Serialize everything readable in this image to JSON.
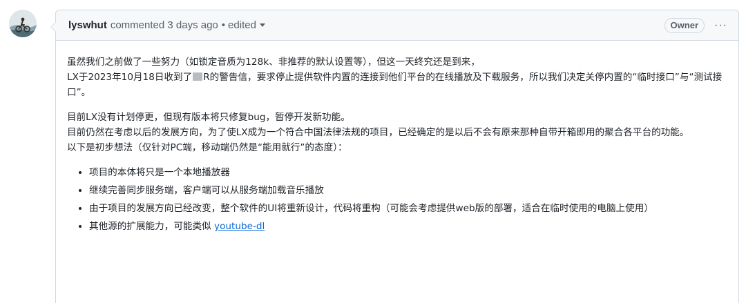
{
  "comment": {
    "author": "lyswhut",
    "action": "commented 3 days ago",
    "separator": "•",
    "edited_label": "edited",
    "badge": "Owner",
    "more_label": "···",
    "avatar_icon": "cyclist-avatar",
    "body": {
      "p1": {
        "line1": "虽然我们之前做了一些努力（如锁定音质为128k、非推荐的默认设置等），但这一天终究还是到来，",
        "line2_before": "LX于2023年10月18日收到了",
        "line2_after": "R的警告信，要求停止提供软件内置的连接到他们平台的在线播放及下载服务，所以我们决定关停内置的“临时接口”与“测试接口”。"
      },
      "p2": {
        "line1": "目前LX没有计划停更，但现有版本将只修复bug，暂停开发新功能。",
        "line2": "目前仍然在考虑以后的发展方向，为了使LX成为一个符合中国法律法规的项目，已经确定的是以后不会有原来那种自带开箱即用的聚合各平台的功能。",
        "line3": "以下是初步想法（仅针对PC端，移动端仍然是“能用就行”的态度）："
      },
      "list": [
        "项目的本体将只是一个本地播放器",
        "继续完善同步服务端，客户端可以从服务端加载音乐播放",
        "由于项目的发展方向已经改变，整个软件的UI将重新设计，代码将重构（可能会考虑提供web版的部署，适合在临时使用的电脑上使用）"
      ],
      "list_last_prefix": "其他源的扩展能力，可能类似 ",
      "list_last_link": "youtube-dl"
    }
  }
}
